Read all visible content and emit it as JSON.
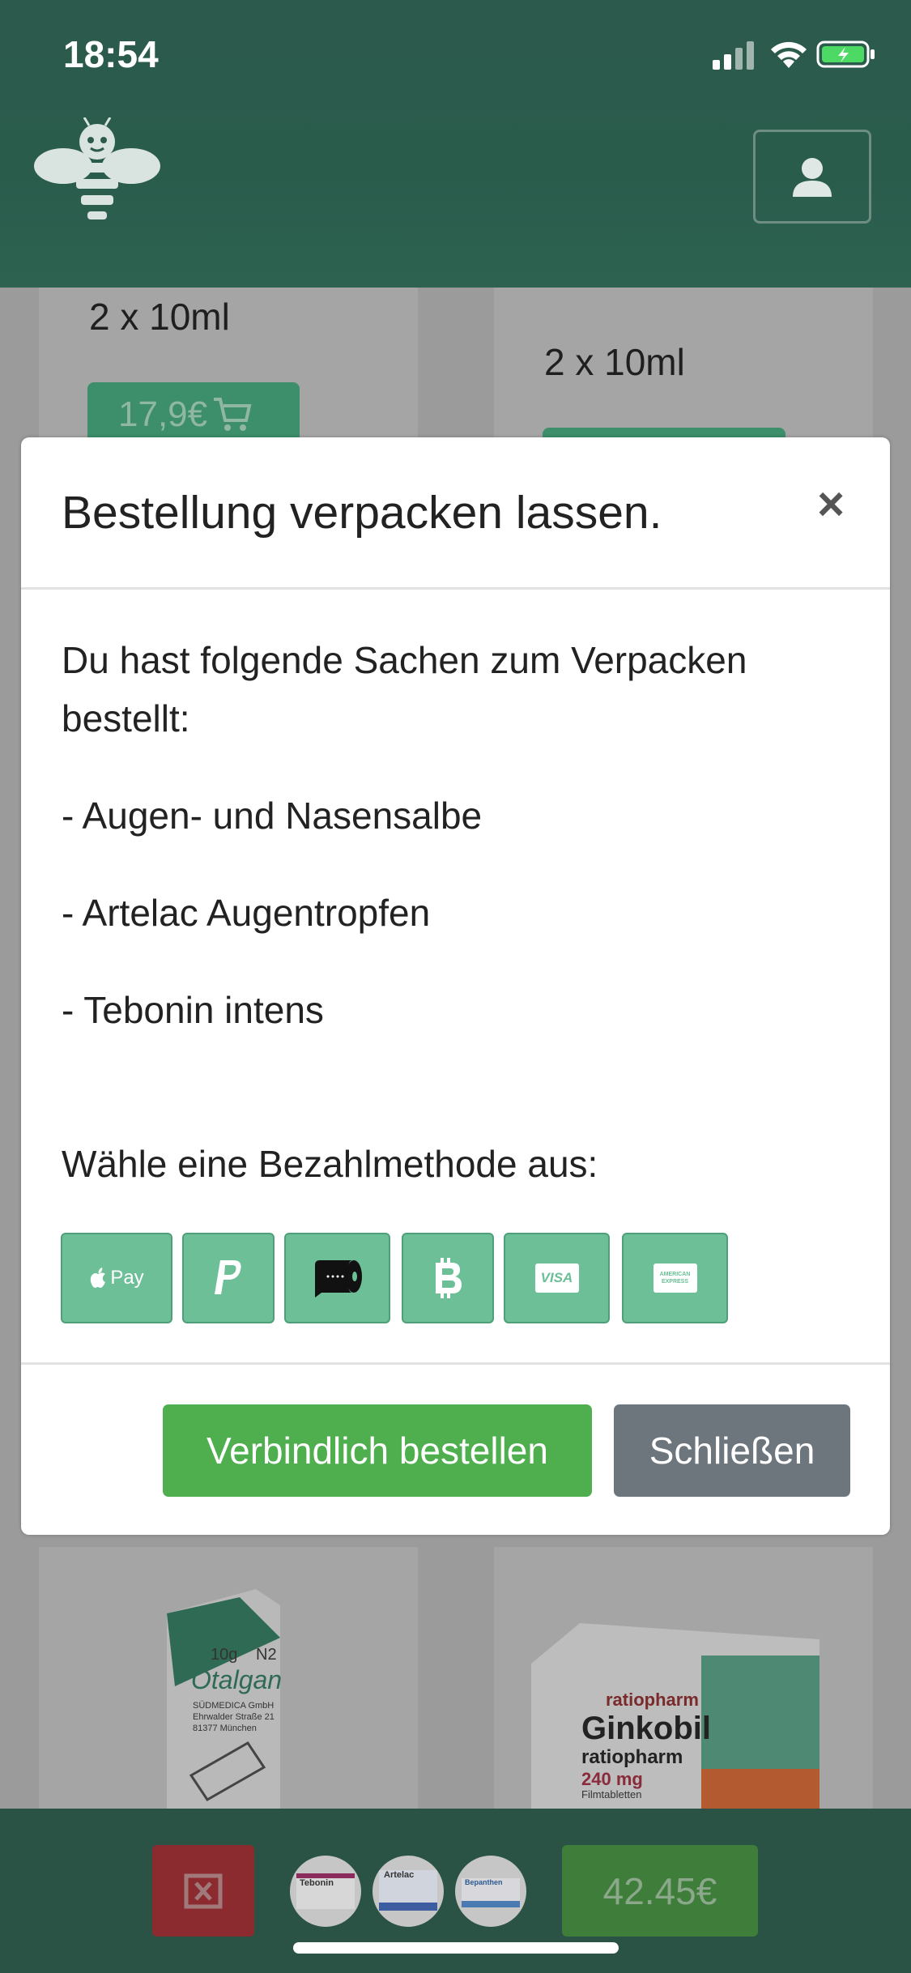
{
  "status_bar": {
    "time": "18:54"
  },
  "background": {
    "card1_size": "2 x 10ml",
    "card1_price": "17,9€",
    "card2_size": "2 x 10ml",
    "product3_brand": "Otalgan",
    "product3_qty": "10g",
    "product3_code": "N2",
    "product3_maker": "SÜDMEDICA GmbH",
    "product3_addr1": "Ehrwalder Straße 21",
    "product3_addr2": "81377 München",
    "product4_maker": "ratiopharm",
    "product4_brand": "Ginkobil",
    "product4_sub": "ratiopharm",
    "product4_dose": "240 mg",
    "product4_form": "Filmtabletten"
  },
  "modal": {
    "title": "Bestellung verpacken lassen.",
    "close_symbol": "×",
    "intro_line1": "Du hast folgende Sachen zum Verpacken",
    "intro_line2": "bestellt:",
    "items": [
      "- Augen- und Nasensalbe",
      "- Artelac Augentropfen",
      "- Tebonin intens"
    ],
    "payment_prompt": "Wähle eine Bezahlmethode aus:",
    "payment_methods": [
      "Apple Pay",
      "PayPal",
      "Toilet Paper",
      "Bitcoin",
      "VISA",
      "American Express"
    ],
    "applepay_label": "Pay",
    "visa_label": "VISA",
    "amex_label": "AMERICAN EXPRESS",
    "order_button": "Verbindlich bestellen",
    "close_button": "Schließen"
  },
  "bottom_bar": {
    "thumbs": [
      "Tebonin",
      "Artelac",
      "Bepanthen"
    ],
    "total": "42.45€"
  },
  "colors": {
    "header": "#2c5a4c",
    "payment_button": "#6cbf97",
    "order_button": "#4faf4e",
    "close_button": "#6d757d",
    "delete_button": "#8c2b2f"
  }
}
